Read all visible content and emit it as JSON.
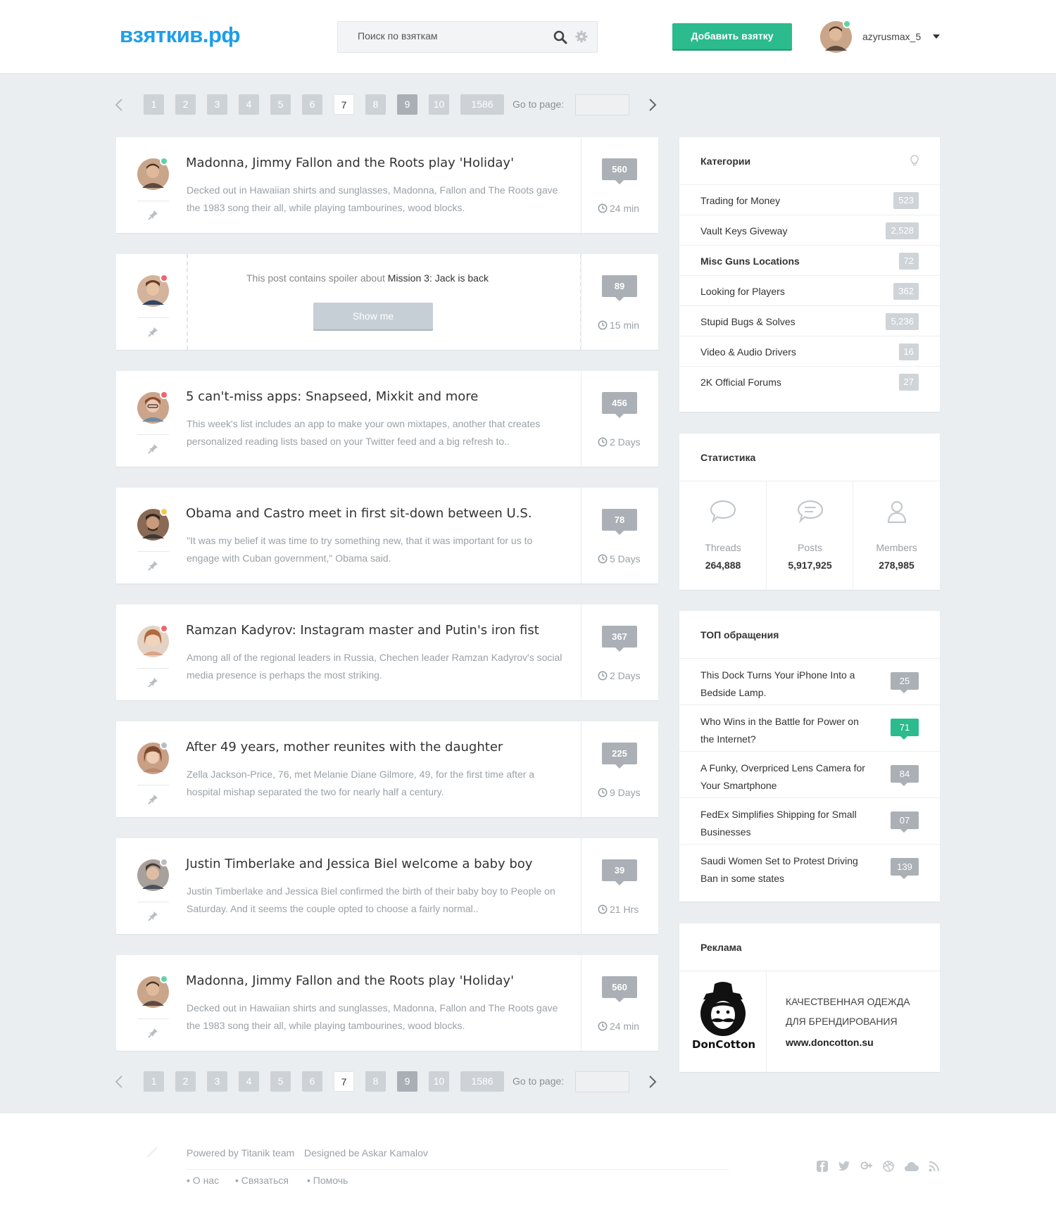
{
  "header": {
    "logo": "взяткив.рф",
    "search_placeholder": "Поиск по взяткам",
    "add_button": "Добавить взятку",
    "username": "azyrusmax_5"
  },
  "pagination": {
    "pages": [
      "1",
      "2",
      "3",
      "4",
      "5",
      "6",
      "7",
      "8",
      "9",
      "10",
      "1586"
    ],
    "current": "7",
    "goto_label": "Go to page:"
  },
  "threads": [
    {
      "title": "Madonna, Jimmy Fallon and the Roots play 'Holiday'",
      "excerpt": "Decked out in Hawaiian shirts and sunglasses, Madonna, Fallon and The Roots gave the 1983 song their all, while playing tambourines, wood blocks.",
      "count": "560",
      "time": "24 min",
      "status_color": "#5fd3a3"
    },
    {
      "spoiler_text": "This post contains spoiler about",
      "spoiler_title": "Mission 3: Jack is back",
      "show_label": "Show me",
      "count": "89",
      "time": "15 min",
      "status_color": "#f0646a"
    },
    {
      "title": "5 can't-miss apps: Snapseed, Mixkit and more",
      "excerpt": "This week's list includes an app to make your own mixtapes, another that creates personalized reading lists based on your Twitter feed and a big refresh to..",
      "count": "456",
      "time": "2 Days",
      "status_color": "#f0646a"
    },
    {
      "title": "Obama and Castro meet in first sit-down between U.S.",
      "excerpt": "\"It was my belief it was time to try something new, that it was important for us to engage with Cuban government,\" Obama said.",
      "count": "78",
      "time": "5 Days",
      "status_color": "#f5c84a"
    },
    {
      "title": "Ramzan Kadyrov: Instagram master and Putin's iron fist",
      "excerpt": "Among all of the regional leaders in Russia, Chechen leader Ramzan Kadyrov's social media presence is perhaps the most striking.",
      "count": "367",
      "time": "2 Days",
      "status_color": "#f0646a"
    },
    {
      "title": "After 49 years, mother reunites with the daughter",
      "excerpt": "Zella Jackson-Price, 76, met Melanie Diane Gilmore, 49, for the first time after a hospital mishap separated the two for nearly half a century.",
      "count": "225",
      "time": "9 Days",
      "status_color": "#b9bec2"
    },
    {
      "title": "Justin Timberlake and Jessica Biel welcome a baby boy",
      "excerpt": "Justin Timberlake and Jessica Biel confirmed the birth of their baby boy to People on Saturday. And it seems the couple opted to choose a fairly normal..",
      "count": "39",
      "time": "21 Hrs",
      "status_color": "#b9bec2"
    },
    {
      "title": "Madonna, Jimmy Fallon and the Roots play 'Holiday'",
      "excerpt": "Decked out in Hawaiian shirts and sunglasses, Madonna, Fallon and The Roots gave the 1983 song their all, while playing tambourines, wood blocks.",
      "count": "560",
      "time": "24 min",
      "status_color": "#5fd3a3"
    }
  ],
  "categories": {
    "title": "Категории",
    "items": [
      {
        "label": "Trading for Money",
        "count": "523"
      },
      {
        "label": "Vault Keys Giveway",
        "count": "2,528"
      },
      {
        "label": "Misc Guns Locations",
        "count": "72"
      },
      {
        "label": "Looking for Players",
        "count": "362"
      },
      {
        "label": "Stupid Bugs & Solves",
        "count": "5,236"
      },
      {
        "label": "Video & Audio Drivers",
        "count": "16"
      },
      {
        "label": "2K Official Forums",
        "count": "27"
      }
    ]
  },
  "stats": {
    "title": "Статистика",
    "items": [
      {
        "label": "Threads",
        "value": "264,888"
      },
      {
        "label": "Posts",
        "value": "5,917,925"
      },
      {
        "label": "Members",
        "value": "278,985"
      }
    ]
  },
  "top": {
    "title": "ТОП обращения",
    "items": [
      {
        "label": "This Dock Turns Your iPhone Into a Bedside Lamp.",
        "count": "25"
      },
      {
        "label": "Who Wins in the Battle for Power on the Internet?",
        "count": "71"
      },
      {
        "label": "A Funky, Overpriced Lens Camera for Your Smartphone",
        "count": "84"
      },
      {
        "label": "FedEx Simplifies Shipping for Small Businesses",
        "count": "07"
      },
      {
        "label": "Saudi Women Set to Protest Driving Ban in some states",
        "count": "139"
      }
    ]
  },
  "ad": {
    "title": "Реклама",
    "brand": "DonCotton",
    "line1": "КАЧЕСТВЕННАЯ ОДЕЖДА",
    "line2": "ДЛЯ БРЕНДИРОВАНИЯ",
    "url": "www.doncotton.su"
  },
  "footer": {
    "powered": "Powered by Titanik team",
    "designed": "Designed be Askar Kamalov",
    "links": [
      "О нас",
      "Связаться",
      "Помочь"
    ]
  },
  "colors": {
    "brand_blue": "#1e9ee8",
    "accent_green": "#2bbb8d",
    "counter_gray": "#aab0b5"
  }
}
